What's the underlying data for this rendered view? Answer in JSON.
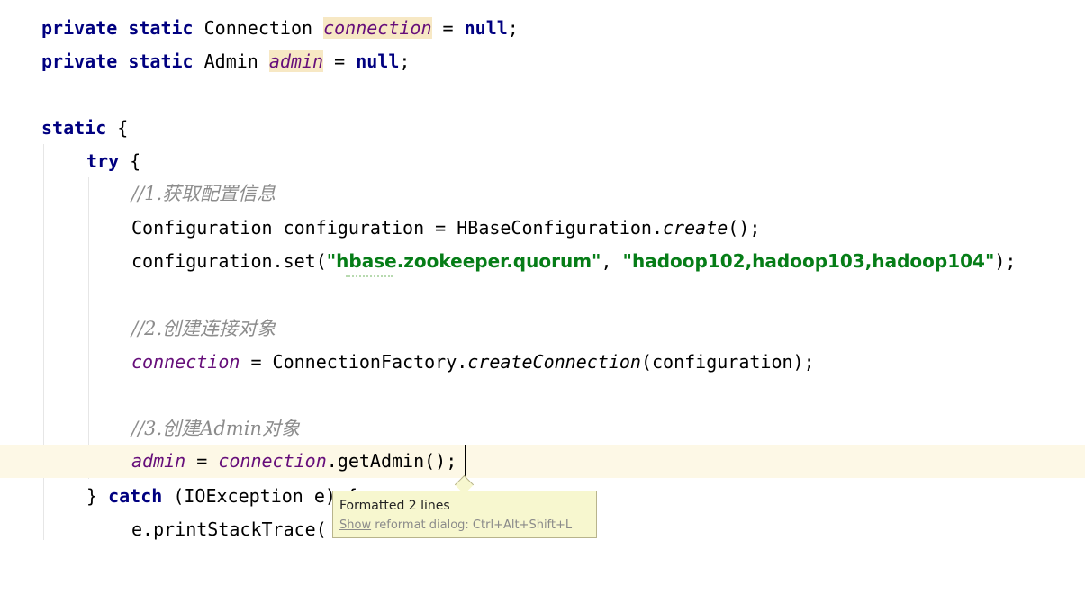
{
  "code": {
    "l1": {
      "kw": "private static",
      "type": " Connection ",
      "var": "connection",
      "rest": " = ",
      "null": "null",
      "semi": ";"
    },
    "l2": {
      "kw": "private static",
      "type": " Admin ",
      "var": "admin",
      "rest": " = ",
      "null": "null",
      "semi": ";"
    },
    "l4": {
      "kw": "static",
      "brace": " {"
    },
    "l5": {
      "kw": "try",
      "brace": " {"
    },
    "l6": {
      "comment": "//1.获取配置信息"
    },
    "l7": {
      "pre": "Configuration configuration = HBaseConfiguration.",
      "method": "create",
      "post": "();"
    },
    "l8": {
      "pre": "configuration.set(",
      "s1": "\"hbase.zookeeper.quorum\"",
      "mid": ", ",
      "s2": "\"hadoop102,hadoop103,hadoop104\"",
      "post": ");"
    },
    "l10": {
      "comment": "//2.创建连接对象"
    },
    "l11": {
      "var": "connection",
      "pre": " = ConnectionFactory.",
      "method": "createConnection",
      "post": "(configuration);"
    },
    "l13": {
      "comment": "//3.创建Admin对象"
    },
    "l14": {
      "var1": "admin",
      "mid": " = ",
      "var2": "connection",
      "post": ".getAdmin();"
    },
    "l15": {
      "brace": "} ",
      "kw": "catch",
      "post": " (IOException e) {"
    },
    "l16": {
      "text": "e.printStackTrace("
    }
  },
  "tooltip": {
    "title": "Formatted 2 lines",
    "link": "Show",
    "hint": " reformat dialog: Ctrl+Alt+Shift+L"
  },
  "colors": {
    "keyword": "#000080",
    "string": "#067d17",
    "comment": "#8c8c8c",
    "field": "#660e7a",
    "current_line": "#fdf8e6",
    "tooltip_bg": "#f7f7cf"
  }
}
